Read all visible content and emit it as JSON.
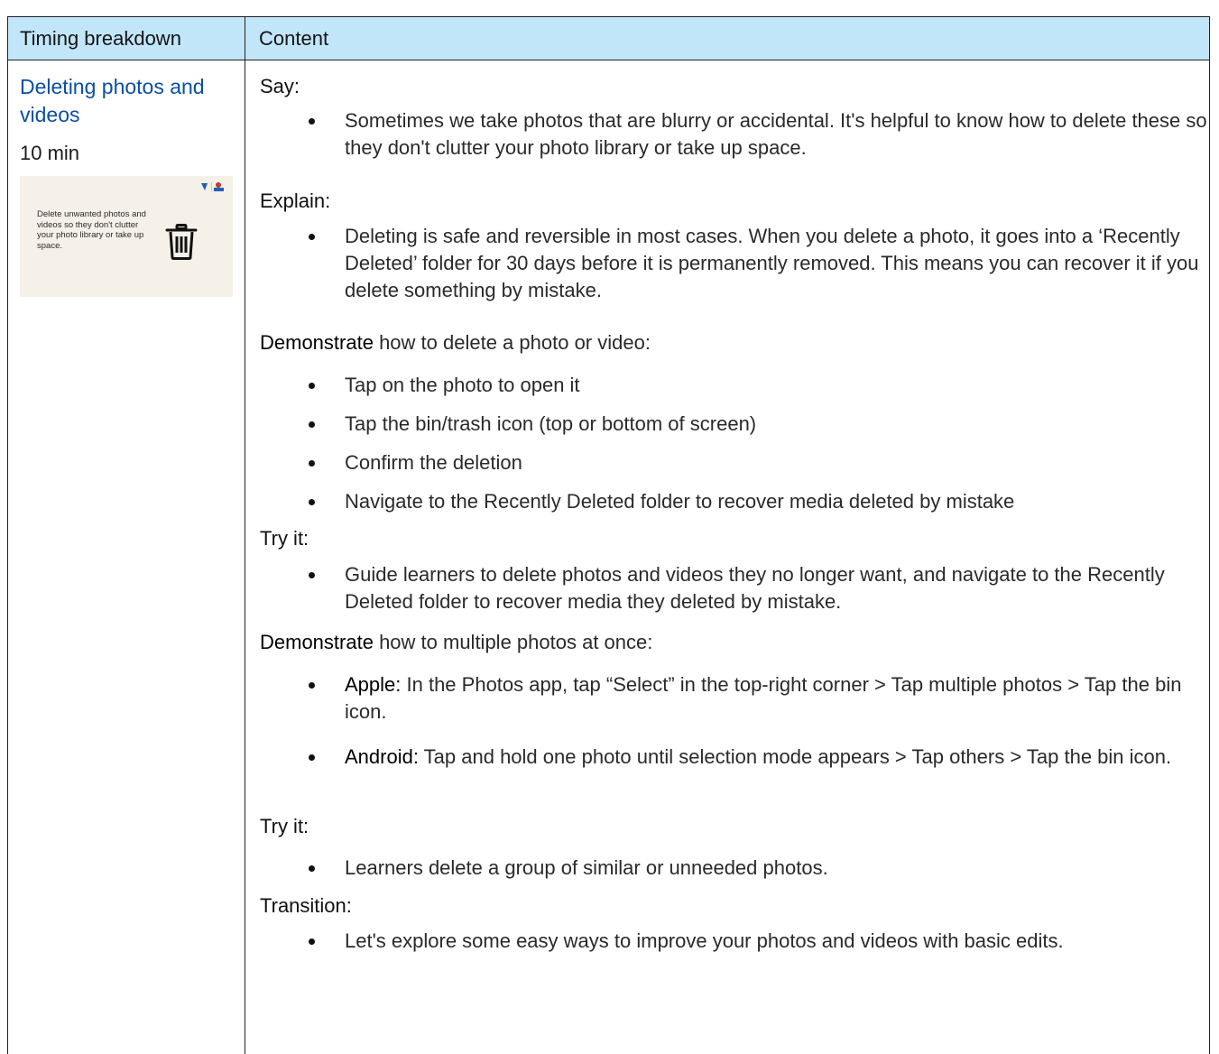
{
  "table": {
    "header": {
      "col1": "Timing breakdown",
      "col2": "Content"
    },
    "section": {
      "title": "Deleting photos and videos",
      "duration": "10 min",
      "slide": {
        "text": "Delete unwanted photos and videos so they don't clutter your photo library or take up space.",
        "icon": "trash-bin-icon",
        "logo": "brand-logo"
      }
    },
    "content": {
      "say_label": "Say:",
      "say_bullets": [
        "Sometimes we take photos that are blurry or accidental. It's helpful to know how to delete these so they don't clutter your photo library or take up space."
      ],
      "explain_label": "Explain:",
      "explain_bullets": [
        "Deleting is safe and reversible in most cases. When you delete a photo, it goes into a ‘Recently Deleted’ folder for 30 days before it is permanently removed. This means you can recover it if you delete something by mistake."
      ],
      "demo1_keyword": "Demonstrate",
      "demo1_rest": " how to delete a photo or video:",
      "demo1_bullets": [
        "Tap on the photo to open it",
        "Tap the bin/trash icon (top or bottom of screen)",
        "Confirm the deletion",
        "Navigate to the Recently Deleted folder to recover media deleted by mistake"
      ],
      "try1_label": "Try it:",
      "try1_bullets": [
        "Guide learners to delete photos and videos they no longer want, and navigate to the Recently Deleted folder to recover media they deleted by mistake."
      ],
      "demo2_keyword": "Demonstrate",
      "demo2_rest": " how to multiple photos at once:",
      "demo2_bullets": [
        {
          "keyword": "Apple:",
          "text": " In the Photos app, tap “Select” in the top-right corner > Tap multiple photos > Tap the bin icon."
        },
        {
          "keyword": "Android:",
          "text": " Tap and hold one photo until selection mode appears > Tap others > Tap the bin icon."
        }
      ],
      "try2_label": "Try it:",
      "try2_bullets": [
        "Learners delete a group of similar or unneeded photos."
      ],
      "transition_label": "Transition:",
      "transition_bullets": [
        "Let's explore some easy ways to improve your photos and videos with basic edits."
      ]
    }
  }
}
